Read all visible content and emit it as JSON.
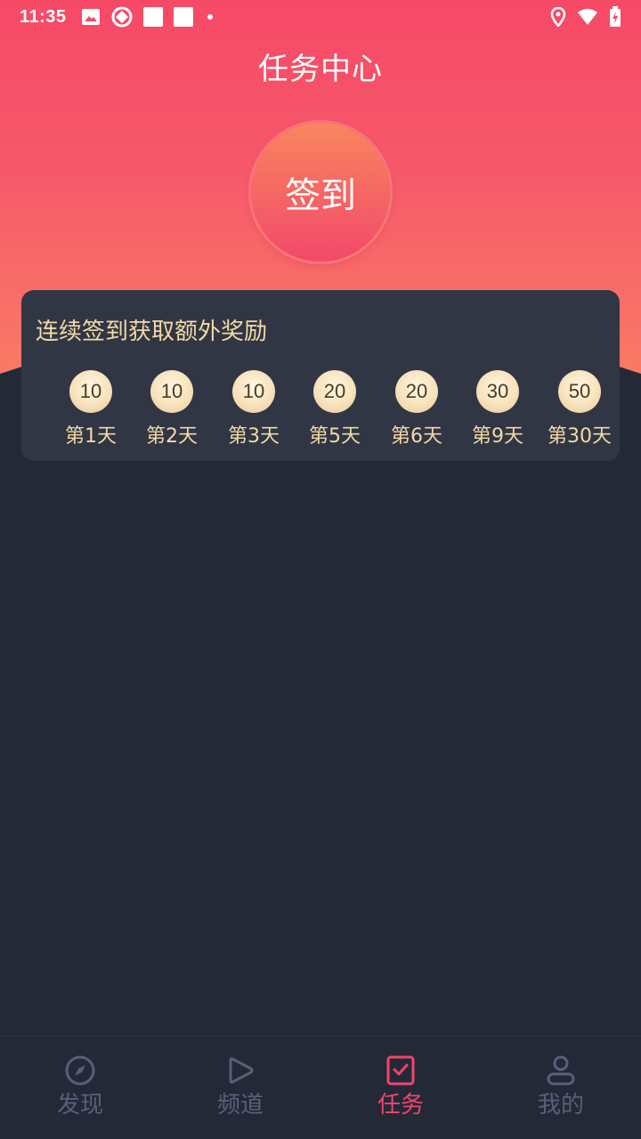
{
  "status_bar": {
    "time": "11:35"
  },
  "page": {
    "title": "任务中心"
  },
  "checkin": {
    "button_label": "签到"
  },
  "rewards": {
    "title": "连续签到获取额外奖励",
    "days": [
      {
        "amount": "10",
        "label": "第1天"
      },
      {
        "amount": "10",
        "label": "第2天"
      },
      {
        "amount": "10",
        "label": "第3天"
      },
      {
        "amount": "20",
        "label": "第5天"
      },
      {
        "amount": "20",
        "label": "第6天"
      },
      {
        "amount": "30",
        "label": "第9天"
      },
      {
        "amount": "50",
        "label": "第30天"
      }
    ]
  },
  "nav": {
    "items": [
      {
        "label": "发现",
        "icon": "compass-icon",
        "active": false
      },
      {
        "label": "频道",
        "icon": "play-icon",
        "active": false
      },
      {
        "label": "任务",
        "icon": "task-check-icon",
        "active": true
      },
      {
        "label": "我的",
        "icon": "person-icon",
        "active": false
      }
    ]
  },
  "colors": {
    "header_gradient_top": "#f64967",
    "header_gradient_bottom": "#fa7a66",
    "background": "#242938",
    "card": "#313645",
    "gold_text": "#f3d9a6",
    "active_nav": "#f0456a",
    "inactive_nav": "#586078"
  }
}
